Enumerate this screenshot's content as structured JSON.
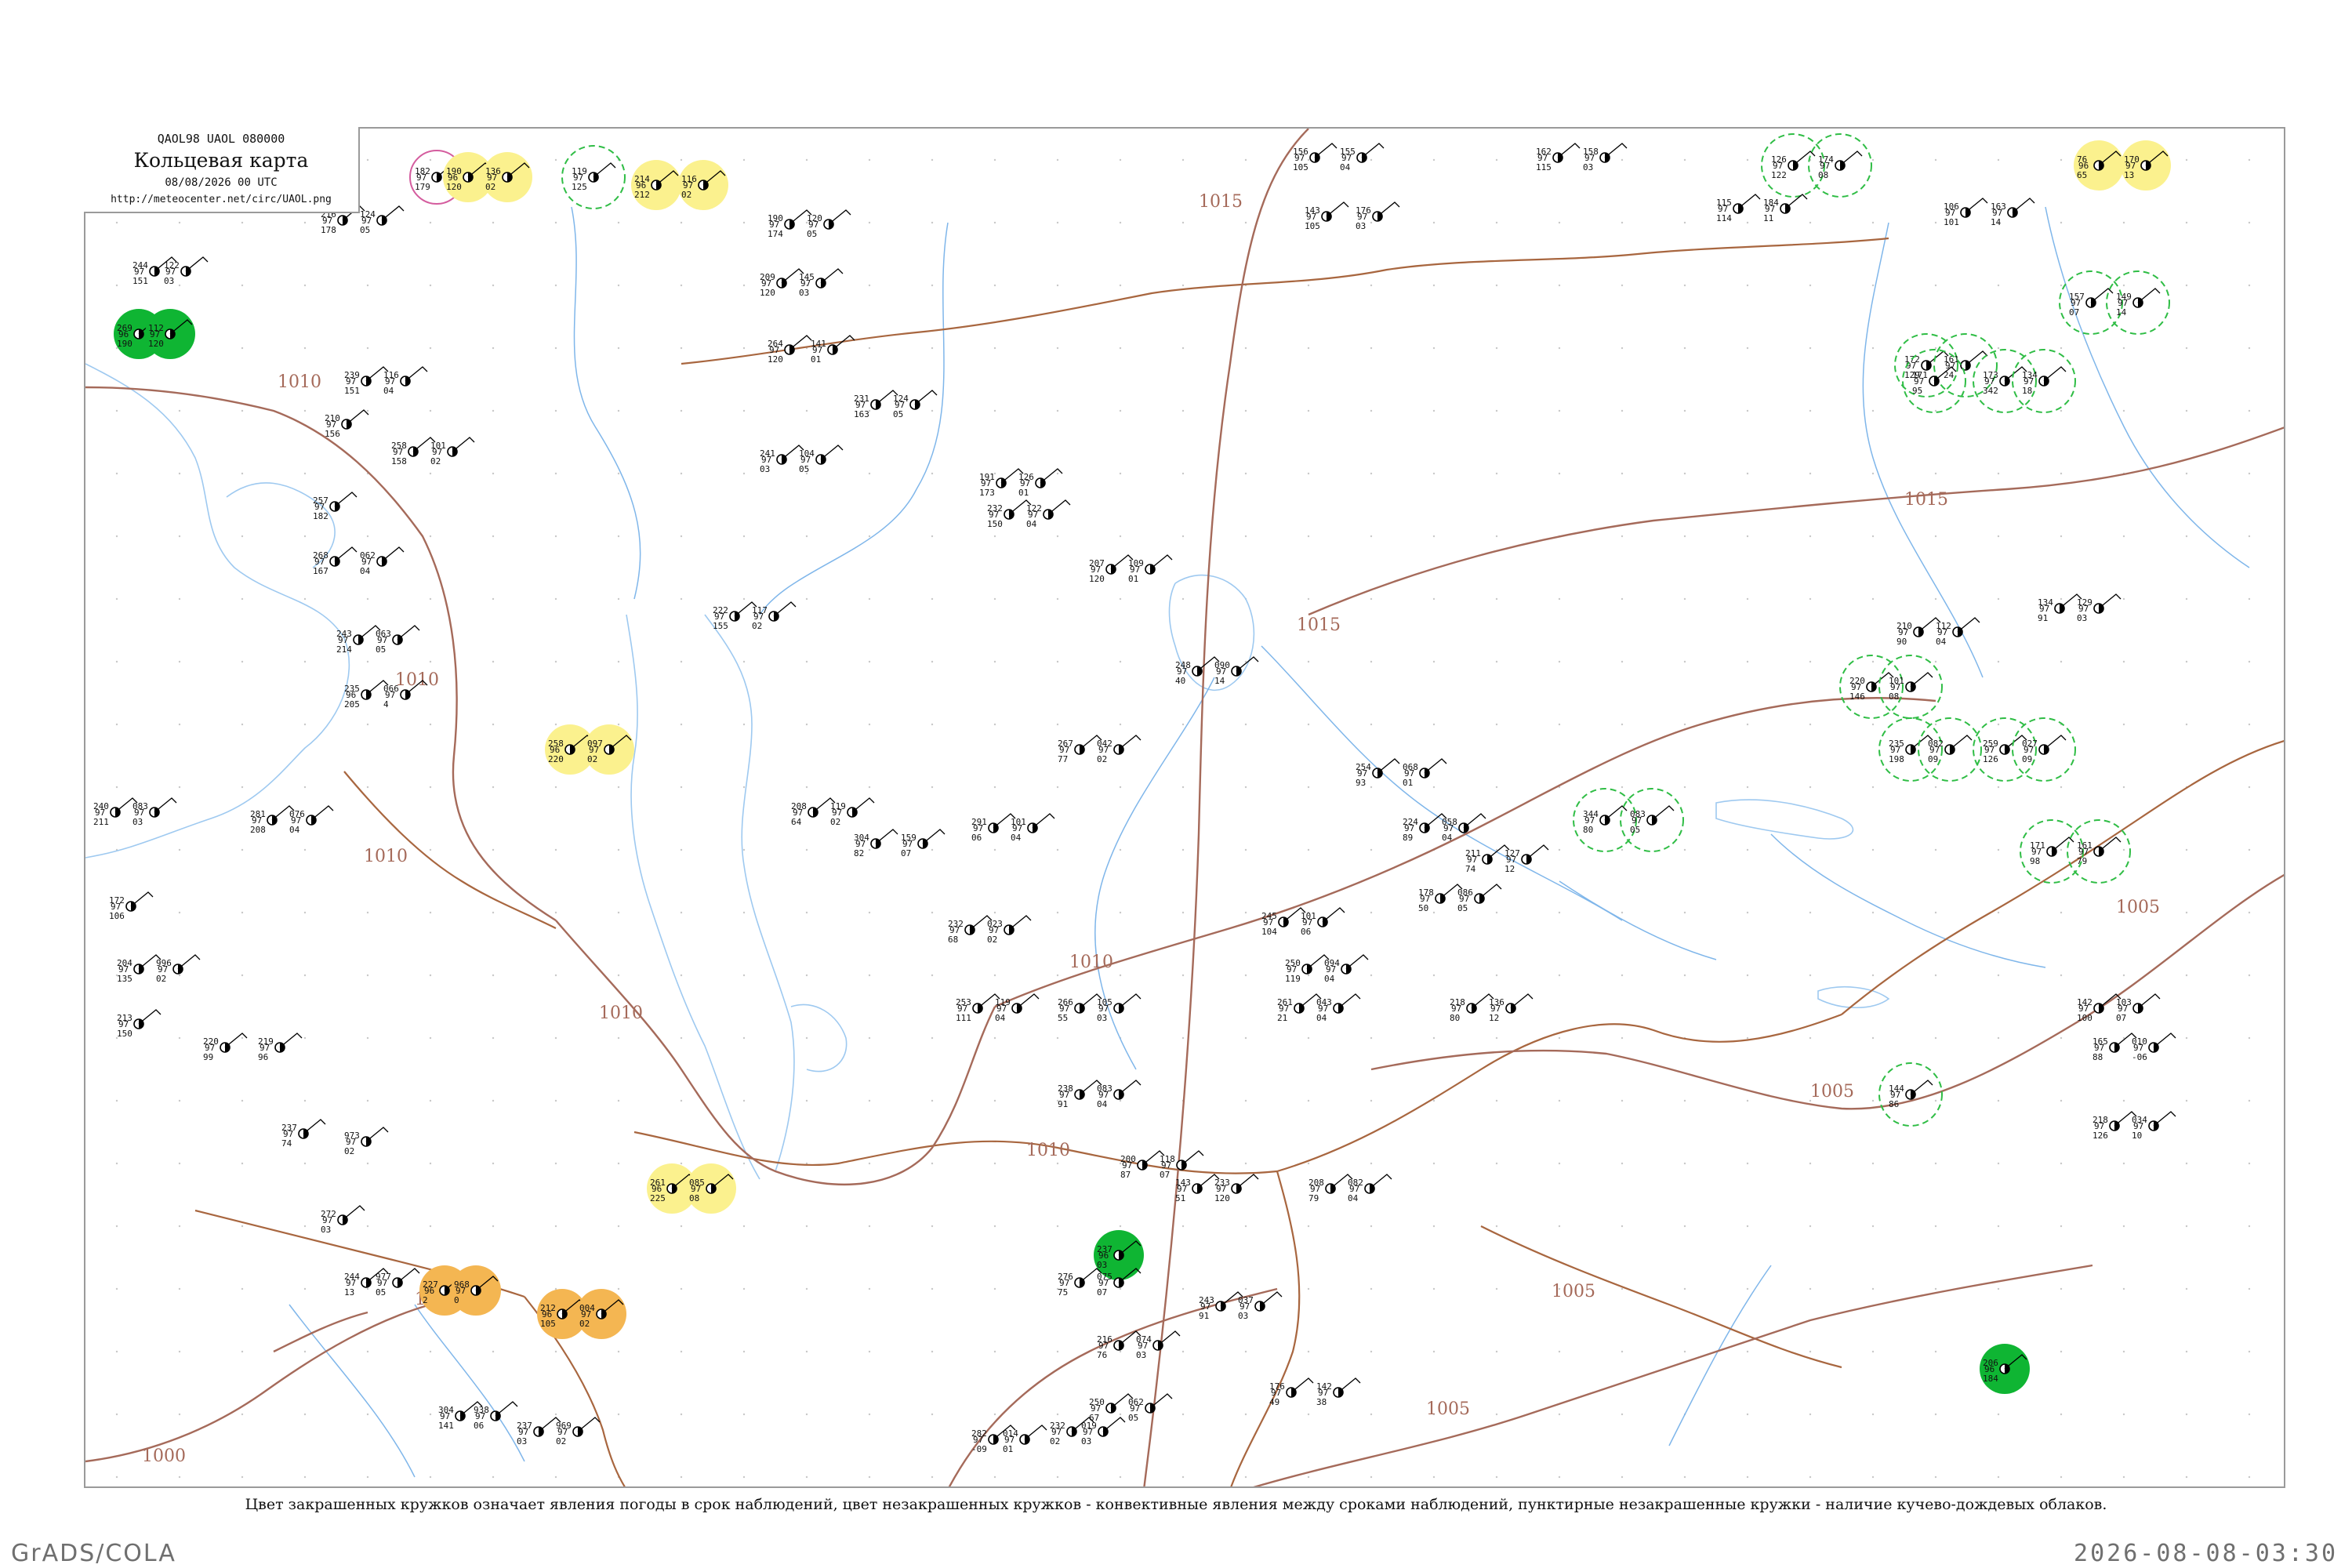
{
  "header": {
    "code": "QAOL98  UAOL  080000",
    "title": "Кольцевая карта",
    "datetime": "08/08/2026 00 UTC",
    "url": "http://meteocenter.net/circ/UAOL.png"
  },
  "caption": "Цвет закрашенных кружков означает явления погоды в срок наблюдений, цвет незакрашенных кружков - конвективные явления между сроками наблюдений, пунктирные незакрашенные кружки - наличие кучево-дождевых облаков.",
  "footer": {
    "left": "GrADS/COLA",
    "right": "2026-08-08-03:30"
  },
  "isobars": [
    {
      "label": "1015",
      "value": 1015
    },
    {
      "label": "1015",
      "value": 1015
    },
    {
      "label": "1015",
      "value": 1015
    },
    {
      "label": "1010",
      "value": 1010
    },
    {
      "label": "1010",
      "value": 1010
    },
    {
      "label": "1010",
      "value": 1010
    },
    {
      "label": "1010",
      "value": 1010
    },
    {
      "label": "1010",
      "value": 1010
    },
    {
      "label": "1010",
      "value": 1010
    },
    {
      "label": "1005",
      "value": 1005
    },
    {
      "label": "1005",
      "value": 1005
    },
    {
      "label": "1005",
      "value": 1005
    },
    {
      "label": "1005",
      "value": 1005
    },
    {
      "label": "1000",
      "value": 1000
    },
    {
      "label": "1000",
      "value": 1000
    }
  ],
  "stations": [
    {
      "pressure": "182",
      "temp": "97",
      "dew": "179",
      "marker": "ring-pink"
    },
    {
      "pressure": "190",
      "temp": "96",
      "dew": "120",
      "marker": "yellow"
    },
    {
      "pressure": "136",
      "temp": "97",
      "dew": "02",
      "marker": "yellow"
    },
    {
      "pressure": "119",
      "temp": "97",
      "dew": "125",
      "marker": "cb-green"
    },
    {
      "pressure": "214",
      "temp": "96",
      "dew": "212",
      "marker": "yellow"
    },
    {
      "pressure": "116",
      "temp": "97",
      "dew": "02",
      "marker": "yellow"
    },
    {
      "pressure": "244",
      "temp": "97",
      "dew": "151",
      "marker": "none"
    },
    {
      "pressure": "122",
      "temp": "97",
      "dew": "03",
      "marker": "none"
    },
    {
      "pressure": "269",
      "temp": "96",
      "dew": "190",
      "marker": "green"
    },
    {
      "pressure": "112",
      "temp": "97",
      "dew": "120",
      "marker": "green"
    },
    {
      "pressure": "126",
      "temp": "97",
      "dew": "122",
      "marker": "cb-green"
    },
    {
      "pressure": "174",
      "temp": "97",
      "dew": "08",
      "marker": "cb-green"
    },
    {
      "pressure": "76",
      "temp": "96",
      "dew": "65",
      "marker": "yellow"
    },
    {
      "pressure": "170",
      "temp": "97",
      "dew": "13",
      "marker": "yellow"
    },
    {
      "pressure": "258",
      "temp": "96",
      "dew": "220",
      "marker": "yellow"
    },
    {
      "pressure": "097",
      "temp": "97",
      "dew": "02",
      "marker": "yellow"
    },
    {
      "pressure": "261",
      "temp": "96",
      "dew": "225",
      "marker": "yellow"
    },
    {
      "pressure": "085",
      "temp": "97",
      "dew": "08",
      "marker": "yellow"
    },
    {
      "pressure": "227",
      "temp": "96",
      "dew": "2",
      "marker": "orange"
    },
    {
      "pressure": "968",
      "temp": "97",
      "dew": "0",
      "marker": "orange"
    },
    {
      "pressure": "212",
      "temp": "96",
      "dew": "105",
      "marker": "orange"
    },
    {
      "pressure": "004",
      "temp": "97",
      "dew": "02",
      "marker": "orange"
    },
    {
      "pressure": "237",
      "temp": "96",
      "dew": "03",
      "marker": "green"
    },
    {
      "pressure": "206",
      "temp": "96",
      "dew": "184",
      "marker": "green"
    },
    {
      "pressure": "344",
      "temp": "97",
      "dew": "80",
      "marker": "cb-green"
    },
    {
      "pressure": "083",
      "temp": "97",
      "dew": "05",
      "marker": "cb-green"
    },
    {
      "pressure": "220",
      "temp": "97",
      "dew": "146",
      "marker": "cb-green"
    },
    {
      "pressure": "101",
      "temp": "97",
      "dew": "08",
      "marker": "cb-green"
    },
    {
      "pressure": "235",
      "temp": "97",
      "dew": "198",
      "marker": "cb-green"
    },
    {
      "pressure": "082",
      "temp": "97",
      "dew": "09",
      "marker": "cb-green"
    },
    {
      "pressure": "259",
      "temp": "97",
      "dew": "126",
      "marker": "cb-green"
    },
    {
      "pressure": "027",
      "temp": "97",
      "dew": "09",
      "marker": "cb-green"
    },
    {
      "pressure": "171",
      "temp": "97",
      "dew": "98",
      "marker": "cb-green"
    },
    {
      "pressure": "161",
      "temp": "97",
      "dew": "79",
      "marker": "cb-green"
    },
    {
      "pressure": "144",
      "temp": "97",
      "dew": "86",
      "marker": "cb-green"
    },
    {
      "pressure": "172",
      "temp": "97",
      "dew": "129",
      "marker": "cb-green"
    },
    {
      "pressure": "161",
      "temp": "97",
      "dew": "24",
      "marker": "cb-green"
    },
    {
      "pressure": "173",
      "temp": "97",
      "dew": "342",
      "marker": "cb-green"
    },
    {
      "pressure": "134",
      "temp": "97",
      "dew": "18",
      "marker": "cb-green"
    },
    {
      "pressure": "157",
      "temp": "97",
      "dew": "07",
      "marker": "cb-green"
    },
    {
      "pressure": "149",
      "temp": "97",
      "dew": "14",
      "marker": "cb-green"
    },
    {
      "pressure": "171",
      "temp": "97",
      "dew": "95",
      "marker": "cb-green"
    },
    {
      "pressure": "156",
      "temp": "97",
      "dew": "105",
      "marker": "none"
    },
    {
      "pressure": "155",
      "temp": "97",
      "dew": "04",
      "marker": "none"
    },
    {
      "pressure": "143",
      "temp": "97",
      "dew": "105",
      "marker": "none"
    },
    {
      "pressure": "176",
      "temp": "97",
      "dew": "03",
      "marker": "none"
    },
    {
      "pressure": "162",
      "temp": "97",
      "dew": "115",
      "marker": "none"
    },
    {
      "pressure": "158",
      "temp": "97",
      "dew": "03",
      "marker": "none"
    },
    {
      "pressure": "115",
      "temp": "97",
      "dew": "114",
      "marker": "none"
    },
    {
      "pressure": "184",
      "temp": "97",
      "dew": "11",
      "marker": "none"
    },
    {
      "pressure": "106",
      "temp": "97",
      "dew": "101",
      "marker": "none"
    },
    {
      "pressure": "163",
      "temp": "97",
      "dew": "14",
      "marker": "none"
    },
    {
      "pressure": "216",
      "temp": "97",
      "dew": "178",
      "marker": "none"
    },
    {
      "pressure": "124",
      "temp": "97",
      "dew": "05",
      "marker": "none"
    },
    {
      "pressure": "239",
      "temp": "97",
      "dew": "151",
      "marker": "none"
    },
    {
      "pressure": "116",
      "temp": "97",
      "dew": "04",
      "marker": "none"
    },
    {
      "pressure": "210",
      "temp": "97",
      "dew": "156",
      "marker": "none"
    },
    {
      "pressure": "258",
      "temp": "97",
      "dew": "158",
      "marker": "none"
    },
    {
      "pressure": "101",
      "temp": "97",
      "dew": "02",
      "marker": "none"
    },
    {
      "pressure": "257",
      "temp": "97",
      "dew": "182",
      "marker": "none"
    },
    {
      "pressure": "268",
      "temp": "97",
      "dew": "167",
      "marker": "none"
    },
    {
      "pressure": "062",
      "temp": "97",
      "dew": "04",
      "marker": "none"
    },
    {
      "pressure": "243",
      "temp": "97",
      "dew": "214",
      "marker": "none"
    },
    {
      "pressure": "063",
      "temp": "97",
      "dew": "05",
      "marker": "none"
    },
    {
      "pressure": "235",
      "temp": "96",
      "dew": "205",
      "marker": "none"
    },
    {
      "pressure": "066",
      "temp": "97",
      "dew": "4",
      "marker": "none"
    },
    {
      "pressure": "240",
      "temp": "97",
      "dew": "211",
      "marker": "none"
    },
    {
      "pressure": "083",
      "temp": "97",
      "dew": "03",
      "marker": "none"
    },
    {
      "pressure": "281",
      "temp": "97",
      "dew": "208",
      "marker": "none"
    },
    {
      "pressure": "076",
      "temp": "97",
      "dew": "04",
      "marker": "none"
    },
    {
      "pressure": "172",
      "temp": "97",
      "dew": "106",
      "marker": "none"
    },
    {
      "pressure": "204",
      "temp": "97",
      "dew": "135",
      "marker": "none"
    },
    {
      "pressure": "996",
      "temp": "97",
      "dew": "02",
      "marker": "none"
    },
    {
      "pressure": "213",
      "temp": "97",
      "dew": "150",
      "marker": "none"
    },
    {
      "pressure": "220",
      "temp": "97",
      "dew": "99",
      "marker": "none"
    },
    {
      "pressure": "219",
      "temp": "97",
      "dew": "96",
      "marker": "none"
    },
    {
      "pressure": "237",
      "temp": "97",
      "dew": "74",
      "marker": "none"
    },
    {
      "pressure": "973",
      "temp": "97",
      "dew": "02",
      "marker": "none"
    },
    {
      "pressure": "272",
      "temp": "97",
      "dew": "03",
      "marker": "none"
    },
    {
      "pressure": "244",
      "temp": "97",
      "dew": "13",
      "marker": "none"
    },
    {
      "pressure": "977",
      "temp": "97",
      "dew": "05",
      "marker": "none"
    },
    {
      "pressure": "304",
      "temp": "97",
      "dew": "141",
      "marker": "none"
    },
    {
      "pressure": "938",
      "temp": "97",
      "dew": "06",
      "marker": "none"
    },
    {
      "pressure": "237",
      "temp": "97",
      "dew": "03",
      "marker": "none"
    },
    {
      "pressure": "969",
      "temp": "97",
      "dew": "02",
      "marker": "none"
    },
    {
      "pressure": "253",
      "temp": "97",
      "dew": "111",
      "marker": "none"
    },
    {
      "pressure": "119",
      "temp": "97",
      "dew": "04",
      "marker": "none"
    },
    {
      "pressure": "266",
      "temp": "97",
      "dew": "55",
      "marker": "none"
    },
    {
      "pressure": "105",
      "temp": "97",
      "dew": "03",
      "marker": "none"
    },
    {
      "pressure": "282",
      "temp": "97",
      "dew": "-09",
      "marker": "none"
    },
    {
      "pressure": "014",
      "temp": "97",
      "dew": "01",
      "marker": "none"
    },
    {
      "pressure": "232",
      "temp": "97",
      "dew": "02",
      "marker": "none"
    },
    {
      "pressure": "019",
      "temp": "97",
      "dew": "03",
      "marker": "none"
    },
    {
      "pressure": "216",
      "temp": "97",
      "dew": "76",
      "marker": "none"
    },
    {
      "pressure": "074",
      "temp": "97",
      "dew": "03",
      "marker": "none"
    },
    {
      "pressure": "142",
      "temp": "97",
      "dew": "100",
      "marker": "none"
    },
    {
      "pressure": "103",
      "temp": "97",
      "dew": "07",
      "marker": "none"
    },
    {
      "pressure": "218",
      "temp": "97",
      "dew": "126",
      "marker": "none"
    },
    {
      "pressure": "034",
      "temp": "97",
      "dew": "10",
      "marker": "none"
    },
    {
      "pressure": "165",
      "temp": "97",
      "dew": "88",
      "marker": "none"
    },
    {
      "pressure": "010",
      "temp": "97",
      "dew": "-06",
      "marker": "none"
    },
    {
      "pressure": "210",
      "temp": "97",
      "dew": "90",
      "marker": "none"
    },
    {
      "pressure": "112",
      "temp": "97",
      "dew": "04",
      "marker": "none"
    },
    {
      "pressure": "134",
      "temp": "97",
      "dew": "91",
      "marker": "none"
    },
    {
      "pressure": "129",
      "temp": "97",
      "dew": "03",
      "marker": "none"
    },
    {
      "pressure": "231",
      "temp": "97",
      "dew": "163",
      "marker": "none"
    },
    {
      "pressure": "124",
      "temp": "97",
      "dew": "05",
      "marker": "none"
    },
    {
      "pressure": "190",
      "temp": "97",
      "dew": "174",
      "marker": "none"
    },
    {
      "pressure": "120",
      "temp": "97",
      "dew": "05",
      "marker": "none"
    },
    {
      "pressure": "209",
      "temp": "97",
      "dew": "120",
      "marker": "none"
    },
    {
      "pressure": "145",
      "temp": "97",
      "dew": "03",
      "marker": "none"
    },
    {
      "pressure": "264",
      "temp": "97",
      "dew": "120",
      "marker": "none"
    },
    {
      "pressure": "141",
      "temp": "97",
      "dew": "01",
      "marker": "none"
    },
    {
      "pressure": "241",
      "temp": "97",
      "dew": "03",
      "marker": "none"
    },
    {
      "pressure": "104",
      "temp": "97",
      "dew": "05",
      "marker": "none"
    },
    {
      "pressure": "191",
      "temp": "97",
      "dew": "173",
      "marker": "none"
    },
    {
      "pressure": "126",
      "temp": "97",
      "dew": "01",
      "marker": "none"
    },
    {
      "pressure": "232",
      "temp": "97",
      "dew": "150",
      "marker": "none"
    },
    {
      "pressure": "122",
      "temp": "97",
      "dew": "04",
      "marker": "none"
    },
    {
      "pressure": "207",
      "temp": "97",
      "dew": "120",
      "marker": "none"
    },
    {
      "pressure": "109",
      "temp": "97",
      "dew": "01",
      "marker": "none"
    },
    {
      "pressure": "222",
      "temp": "97",
      "dew": "155",
      "marker": "none"
    },
    {
      "pressure": "117",
      "temp": "97",
      "dew": "02",
      "marker": "none"
    },
    {
      "pressure": "208",
      "temp": "97",
      "dew": "64",
      "marker": "none"
    },
    {
      "pressure": "119",
      "temp": "97",
      "dew": "02",
      "marker": "none"
    },
    {
      "pressure": "304",
      "temp": "97",
      "dew": "82",
      "marker": "none"
    },
    {
      "pressure": "159",
      "temp": "97",
      "dew": "07",
      "marker": "none"
    },
    {
      "pressure": "291",
      "temp": "97",
      "dew": "06",
      "marker": "none"
    },
    {
      "pressure": "101",
      "temp": "97",
      "dew": "04",
      "marker": "none"
    },
    {
      "pressure": "248",
      "temp": "97",
      "dew": "40",
      "marker": "none"
    },
    {
      "pressure": "090",
      "temp": "97",
      "dew": "14",
      "marker": "none"
    },
    {
      "pressure": "250",
      "temp": "97",
      "dew": "119",
      "marker": "none"
    },
    {
      "pressure": "094",
      "temp": "97",
      "dew": "04",
      "marker": "none"
    },
    {
      "pressure": "245",
      "temp": "97",
      "dew": "104",
      "marker": "none"
    },
    {
      "pressure": "101",
      "temp": "97",
      "dew": "06",
      "marker": "none"
    },
    {
      "pressure": "211",
      "temp": "97",
      "dew": "74",
      "marker": "none"
    },
    {
      "pressure": "127",
      "temp": "97",
      "dew": "12",
      "marker": "none"
    },
    {
      "pressure": "224",
      "temp": "97",
      "dew": "89",
      "marker": "none"
    },
    {
      "pressure": "058",
      "temp": "97",
      "dew": "04",
      "marker": "none"
    },
    {
      "pressure": "254",
      "temp": "97",
      "dew": "93",
      "marker": "none"
    },
    {
      "pressure": "068",
      "temp": "97",
      "dew": "01",
      "marker": "none"
    },
    {
      "pressure": "178",
      "temp": "97",
      "dew": "50",
      "marker": "none"
    },
    {
      "pressure": "086",
      "temp": "97",
      "dew": "05",
      "marker": "none"
    },
    {
      "pressure": "261",
      "temp": "97",
      "dew": "21",
      "marker": "none"
    },
    {
      "pressure": "043",
      "temp": "97",
      "dew": "04",
      "marker": "none"
    },
    {
      "pressure": "218",
      "temp": "97",
      "dew": "80",
      "marker": "none"
    },
    {
      "pressure": "136",
      "temp": "97",
      "dew": "12",
      "marker": "none"
    },
    {
      "pressure": "200",
      "temp": "97",
      "dew": "87",
      "marker": "none"
    },
    {
      "pressure": "118",
      "temp": "97",
      "dew": "07",
      "marker": "none"
    },
    {
      "pressure": "276",
      "temp": "97",
      "dew": "75",
      "marker": "none"
    },
    {
      "pressure": "075",
      "temp": "97",
      "dew": "07",
      "marker": "none"
    },
    {
      "pressure": "208",
      "temp": "97",
      "dew": "79",
      "marker": "none"
    },
    {
      "pressure": "082",
      "temp": "97",
      "dew": "04",
      "marker": "none"
    },
    {
      "pressure": "243",
      "temp": "97",
      "dew": "91",
      "marker": "none"
    },
    {
      "pressure": "037",
      "temp": "97",
      "dew": "03",
      "marker": "none"
    },
    {
      "pressure": "267",
      "temp": "97",
      "dew": "77",
      "marker": "none"
    },
    {
      "pressure": "042",
      "temp": "97",
      "dew": "02",
      "marker": "none"
    },
    {
      "pressure": "232",
      "temp": "97",
      "dew": "68",
      "marker": "none"
    },
    {
      "pressure": "023",
      "temp": "97",
      "dew": "02",
      "marker": "none"
    },
    {
      "pressure": "238",
      "temp": "97",
      "dew": "91",
      "marker": "none"
    },
    {
      "pressure": "083",
      "temp": "97",
      "dew": "04",
      "marker": "none"
    },
    {
      "pressure": "250",
      "temp": "97",
      "dew": "67",
      "marker": "none"
    },
    {
      "pressure": "062",
      "temp": "97",
      "dew": "05",
      "marker": "none"
    },
    {
      "pressure": "143",
      "temp": "97",
      "dew": "51",
      "marker": "none"
    },
    {
      "pressure": "233",
      "temp": "97",
      "dew": "120",
      "marker": "none"
    },
    {
      "pressure": "176",
      "temp": "97",
      "dew": "49",
      "marker": "none"
    },
    {
      "pressure": "142",
      "temp": "97",
      "dew": "38",
      "marker": "none"
    }
  ]
}
